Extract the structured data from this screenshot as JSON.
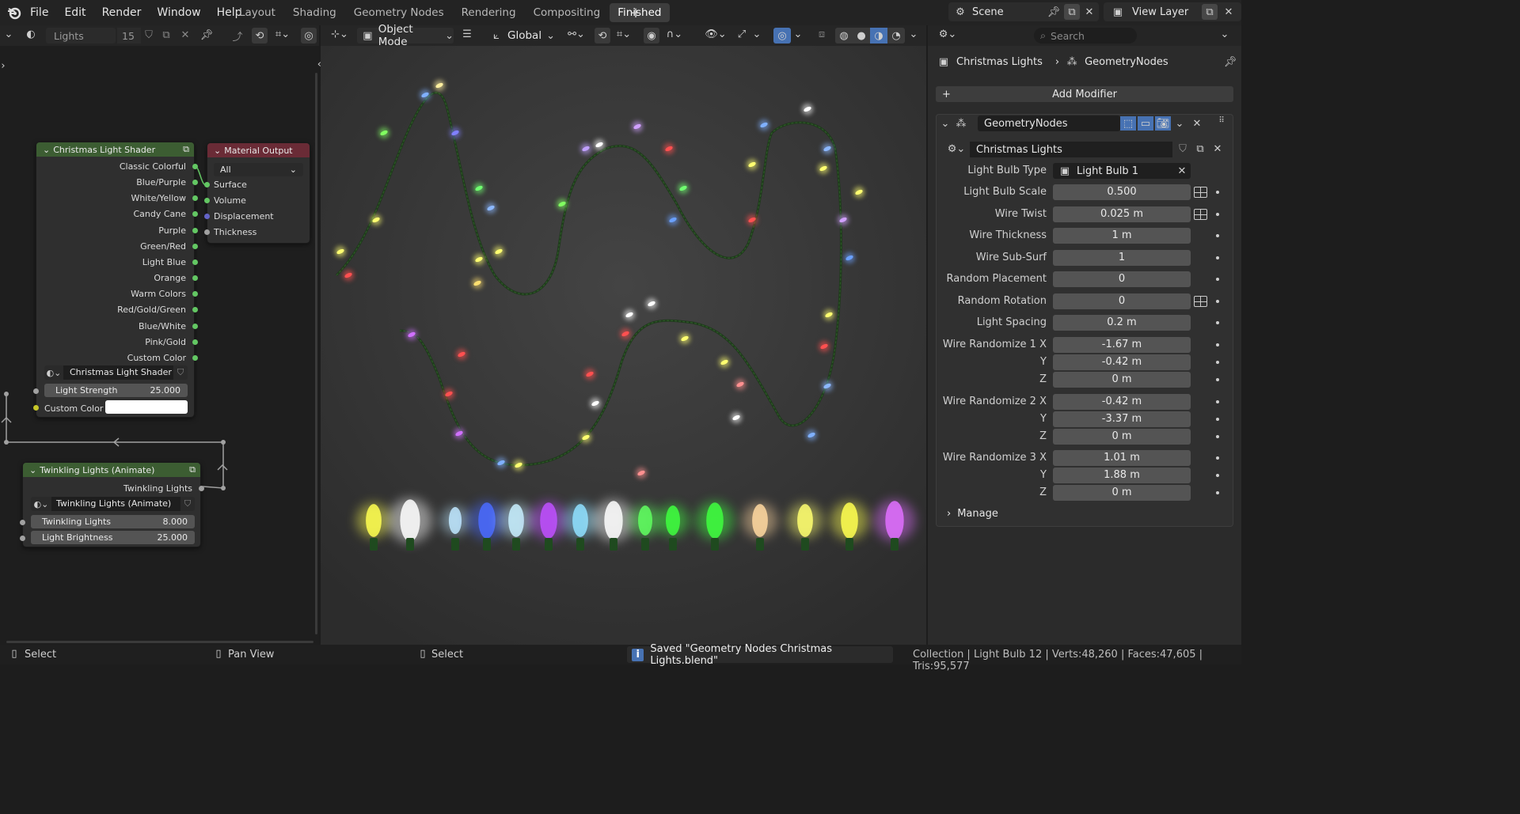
{
  "menu": [
    "File",
    "Edit",
    "Render",
    "Window",
    "Help"
  ],
  "workspaces": [
    "Layout",
    "Shading",
    "Geometry Nodes",
    "Rendering",
    "Compositing",
    "Finished"
  ],
  "active_workspace": "Finished",
  "scene": "Scene",
  "view_layer": "View Layer",
  "node_editor": {
    "material_name": "Lights",
    "users": "15",
    "shader_node": {
      "title": "Christmas Light Shader",
      "outputs": [
        "Classic Colorful",
        "Blue/Purple",
        "White/Yellow",
        "Candy Cane",
        "Purple",
        "Green/Red",
        "Light Blue",
        "Orange",
        "Warm Colors",
        "Red/Gold/Green",
        "Blue/White",
        "Pink/Gold",
        "Custom Color"
      ],
      "group_name": "Christmas Light Shader",
      "strength_label": "Light Strength",
      "strength_value": "25.000",
      "custom_color_label": "Custom Color",
      "custom_color": "#ffffff"
    },
    "output_node": {
      "title": "Material Output",
      "target": "All",
      "inputs": [
        "Surface",
        "Volume",
        "Displacement",
        "Thickness"
      ]
    },
    "twinkle_node": {
      "title": "Twinkling Lights (Animate)",
      "output": "Twinkling Lights",
      "group_name": "Twinkling Lights (Animate)",
      "fields": [
        {
          "label": "Twinkling Lights",
          "value": "8.000"
        },
        {
          "label": "Light Brightness",
          "value": "25.000"
        }
      ]
    }
  },
  "viewport": {
    "mode": "Object Mode",
    "orientation": "Global"
  },
  "properties": {
    "search_placeholder": "Search",
    "breadcrumb": [
      "Christmas Lights",
      "GeometryNodes"
    ],
    "add_modifier": "Add Modifier",
    "modifier_name": "GeometryNodes",
    "node_group": "Christmas Lights",
    "bulb_type_label": "Light Bulb Type",
    "bulb_type_value": "Light Bulb 1",
    "params": [
      {
        "label": "Light Bulb Scale",
        "value": "0.500"
      },
      {
        "label": "Wire Twist",
        "value": "0.025 m"
      },
      {
        "label": "Wire Thickness",
        "value": "1 m"
      },
      {
        "label": "Wire Sub-Surf",
        "value": "1"
      },
      {
        "label": "Random Placement",
        "value": "0"
      },
      {
        "label": "Random Rotation",
        "value": "0"
      },
      {
        "label": "Light Spacing",
        "value": "0.2 m"
      },
      {
        "label": "Wire Randomize 1 X",
        "value": "-1.67 m"
      },
      {
        "label": "Y",
        "value": "-0.42 m"
      },
      {
        "label": "Z",
        "value": "0 m"
      },
      {
        "label": "Wire Randomize 2 X",
        "value": "-0.42 m"
      },
      {
        "label": "Y",
        "value": "-3.37 m"
      },
      {
        "label": "Z",
        "value": "0 m"
      },
      {
        "label": "Wire Randomize 3 X",
        "value": "1.01 m"
      },
      {
        "label": "Y",
        "value": "1.88 m"
      },
      {
        "label": "Z",
        "value": "0 m"
      }
    ],
    "manage": "Manage"
  },
  "status": {
    "left": "Select",
    "middle": "Pan View",
    "right": "Select",
    "message": "Saved \"Geometry Nodes Christmas Lights.blend\"",
    "stats": "Collection | Light Bulb 12 | Verts:48,260 | Faces:47,605 | Tris:95,577"
  },
  "colors": {
    "accent": "#4772b3",
    "node_header_green": "#3c5d32",
    "node_header_red": "#6a2b36",
    "socket_green": "#63c763",
    "socket_purple": "#6363c7",
    "socket_gray": "#a1a1a1",
    "socket_yellow": "#c7c729"
  }
}
